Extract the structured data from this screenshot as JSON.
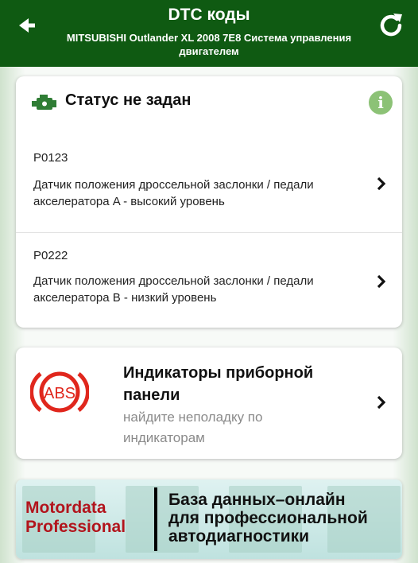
{
  "header": {
    "title": "DTC коды",
    "subtitle": "MITSUBISHI Outlander XL 2008 7E8 Система управления двигателем",
    "back_icon": "arrow-left-icon",
    "refresh_icon": "refresh-icon"
  },
  "status": {
    "title": "Статус не задан",
    "engine_icon": "engine-icon",
    "info_icon": "info-icon"
  },
  "dtc_items": [
    {
      "code": "P0123",
      "description": "Датчик положения дроссельной заслонки / педали акселератора A - высокий уровень"
    },
    {
      "code": "P0222",
      "description": "Датчик положения дроссельной заслонки / педали акселератора B - низкий уровень"
    }
  ],
  "dashboard_card": {
    "title": "Индикаторы приборной панели",
    "subtitle": "найдите неполадку по индикаторам",
    "abs_label": "ABS"
  },
  "banner": {
    "brand_line1": "Motordata",
    "brand_line2": "Professional",
    "text_line1": "База данных–онлайн",
    "text_line2": "для профессиональной",
    "text_line3": "автодиагностики"
  },
  "colors": {
    "header_bg": "#0f5a12",
    "info_green": "#8cc276",
    "abs_red": "#e0271d",
    "brand_red": "#b2141c"
  }
}
